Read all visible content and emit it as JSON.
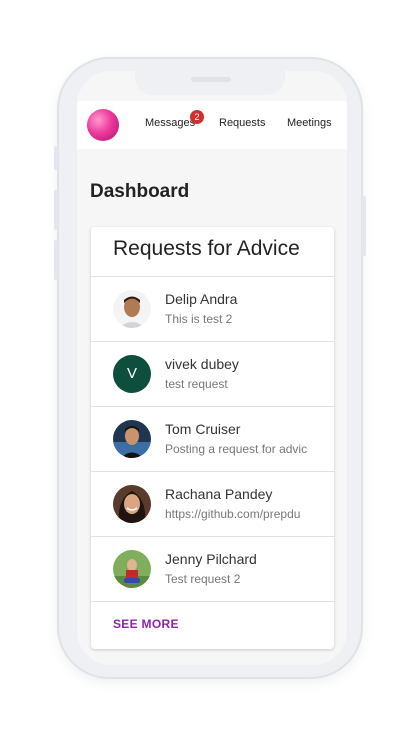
{
  "nav": {
    "messages_label": "Messages",
    "messages_badge": "2",
    "requests_label": "Requests",
    "meetings_label": "Meetings"
  },
  "page": {
    "title": "Dashboard"
  },
  "card": {
    "title": "Requests for Advice",
    "items": [
      {
        "name": "Delip Andra",
        "text": "This is test 2",
        "avatar": "photo"
      },
      {
        "name": "vivek dubey",
        "text": "test request",
        "avatar": "letter",
        "letter": "V"
      },
      {
        "name": "Tom Cruiser",
        "text": "Posting a request for advic",
        "avatar": "photo"
      },
      {
        "name": "Rachana Pandey",
        "text": "https://github.com/prepdu",
        "avatar": "photo"
      },
      {
        "name": "Jenny Pilchard",
        "text": "Test request 2",
        "avatar": "photo"
      }
    ],
    "see_more_label": "SEE MORE"
  },
  "colors": {
    "badge": "#d32f2f",
    "accent": "#8e24aa",
    "letter_avatar": "#0d4f3c"
  }
}
